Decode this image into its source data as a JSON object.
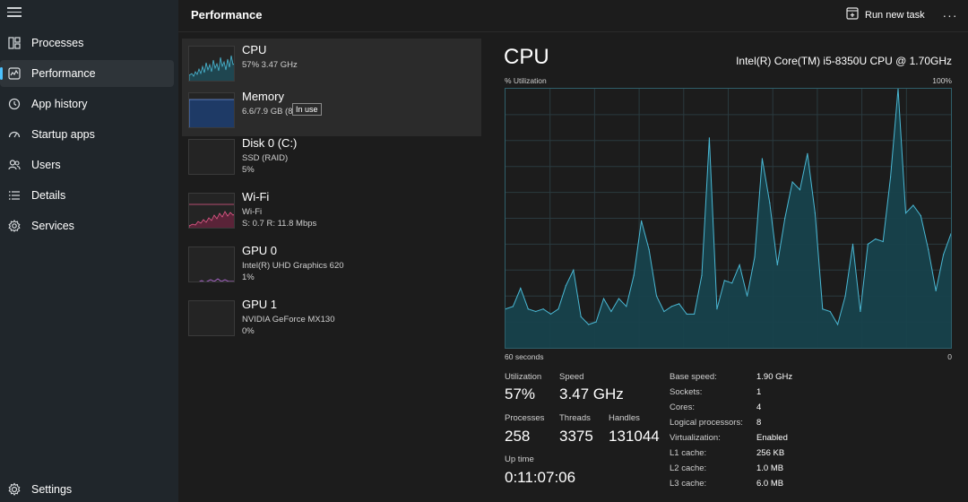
{
  "header": {
    "title": "Performance",
    "run_task_label": "Run new task",
    "more_label": "···"
  },
  "sidebar": {
    "items": [
      {
        "label": "Processes",
        "icon": "processes-grid-icon"
      },
      {
        "label": "Performance",
        "icon": "performance-chart-icon",
        "active": true
      },
      {
        "label": "App history",
        "icon": "history-clock-icon"
      },
      {
        "label": "Startup apps",
        "icon": "speedometer-icon"
      },
      {
        "label": "Users",
        "icon": "users-icon"
      },
      {
        "label": "Details",
        "icon": "details-list-icon"
      },
      {
        "label": "Services",
        "icon": "services-puzzle-icon"
      }
    ],
    "settings_label": "Settings"
  },
  "devices": [
    {
      "name": "CPU",
      "sub": "57%  3.47 GHz",
      "sub2": "",
      "active": true,
      "graph_color": "#4ab8d4"
    },
    {
      "name": "Memory",
      "sub": "6.6/7.9 GB (8",
      "sub2": "",
      "graph_color": "#6c8fd6"
    },
    {
      "name": "Disk 0 (C:)",
      "sub": "SSD (RAID)",
      "sub2": "5%",
      "graph_color": "#7bc26b"
    },
    {
      "name": "Wi-Fi",
      "sub": "Wi-Fi",
      "sub2": "S: 0.7  R: 11.8 Mbps",
      "graph_color": "#e65a8a"
    },
    {
      "name": "GPU 0",
      "sub": "Intel(R) UHD Graphics 620",
      "sub2": "1%",
      "graph_color": "#b36ad6"
    },
    {
      "name": "GPU 1",
      "sub": "NVIDIA GeForce MX130",
      "sub2": "0%",
      "graph_color": "#b36ad6"
    }
  ],
  "tooltip": "In use",
  "detail": {
    "title": "CPU",
    "model": "Intel(R) Core(TM) i5-8350U CPU @ 1.70GHz",
    "util_axis_label": "% Utilization",
    "util_axis_max": "100%",
    "time_axis_left": "60 seconds",
    "time_axis_right": "0",
    "accent_color": "#4ab8d4"
  },
  "stats": {
    "utilization_label": "Utilization",
    "utilization": "57%",
    "speed_label": "Speed",
    "speed": "3.47 GHz",
    "processes_label": "Processes",
    "processes": "258",
    "threads_label": "Threads",
    "threads": "3375",
    "handles_label": "Handles",
    "handles": "131044",
    "uptime_label": "Up time",
    "uptime": "0:11:07:06"
  },
  "specs": [
    {
      "key": "Base speed:",
      "value": "1.90 GHz"
    },
    {
      "key": "Sockets:",
      "value": "1"
    },
    {
      "key": "Cores:",
      "value": "4"
    },
    {
      "key": "Logical processors:",
      "value": "8"
    },
    {
      "key": "Virtualization:",
      "value": "Enabled"
    },
    {
      "key": "L1 cache:",
      "value": "256 KB"
    },
    {
      "key": "L2 cache:",
      "value": "1.0 MB"
    },
    {
      "key": "L3 cache:",
      "value": "6.0 MB"
    }
  ],
  "chart_data": {
    "type": "area",
    "x_range": [
      60,
      0
    ],
    "ylim": [
      0,
      100
    ],
    "grid": true,
    "values": [
      15,
      16,
      23,
      15,
      14,
      15,
      13,
      15,
      24,
      30,
      12,
      9,
      10,
      19,
      14,
      19,
      16,
      28,
      49,
      38,
      20,
      14,
      16,
      17,
      13,
      13,
      28,
      81,
      15,
      26,
      25,
      32,
      20,
      35,
      73,
      56,
      32,
      50,
      64,
      61,
      75,
      52,
      15,
      14,
      9,
      20,
      40,
      14,
      40,
      42,
      41,
      66,
      100,
      52,
      55,
      51,
      38,
      22,
      36,
      44
    ]
  }
}
